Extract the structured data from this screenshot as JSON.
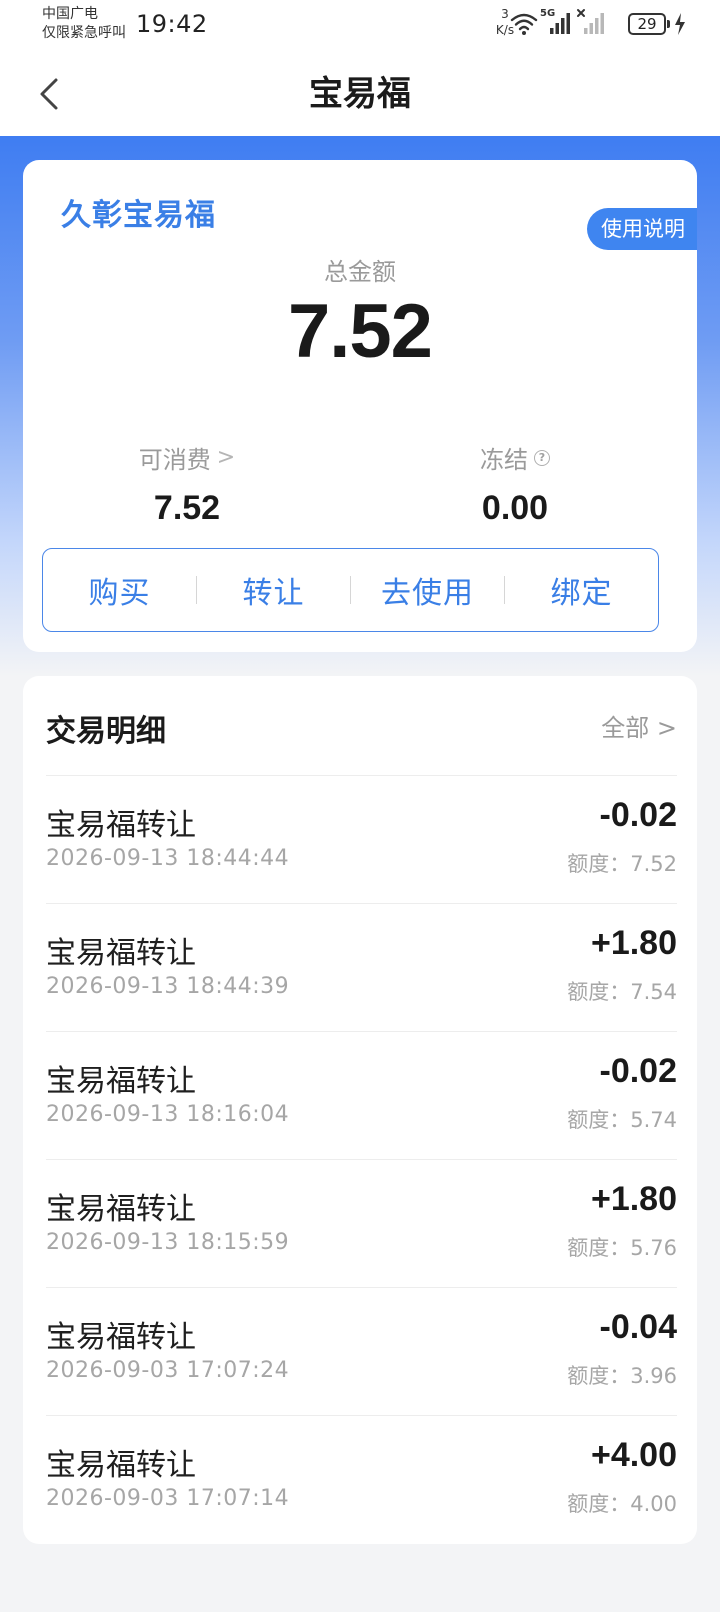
{
  "status_bar": {
    "carrier_line1": "中国广电",
    "carrier_line2": "仅限紧急呼叫",
    "time": "19:42",
    "net_speed_value": "3",
    "net_speed_unit": "K/s",
    "network_label": "5G",
    "battery_level": "29",
    "icons": [
      "wifi-icon",
      "signal-5g-icon",
      "signal-no-service-icon",
      "charging-icon"
    ]
  },
  "nav": {
    "title": "宝易福",
    "back_icon": "chevron-left-icon"
  },
  "summary": {
    "brand": "久彰宝易福",
    "instructions_label": "使用说明",
    "total_label": "总金额",
    "total_amount": "7.52",
    "available_label": "可消费",
    "available_chevron": ">",
    "available_value": "7.52",
    "frozen_label": "冻结",
    "frozen_help_glyph": "?",
    "frozen_value": "0.00",
    "actions": [
      {
        "label": "购买"
      },
      {
        "label": "转让"
      },
      {
        "label": "去使用"
      },
      {
        "label": "绑定"
      }
    ]
  },
  "transactions": {
    "title": "交易明细",
    "all_label": "全部 >",
    "items": [
      {
        "name": "宝易福转让",
        "time": "2026-09-13 18:44:44",
        "amount": "-0.02",
        "balance": "额度：7.52"
      },
      {
        "name": "宝易福转让",
        "time": "2026-09-13 18:44:39",
        "amount": "+1.80",
        "balance": "额度：7.54"
      },
      {
        "name": "宝易福转让",
        "time": "2026-09-13 18:16:04",
        "amount": "-0.02",
        "balance": "额度：5.74"
      },
      {
        "name": "宝易福转让",
        "time": "2026-09-13 18:15:59",
        "amount": "+1.80",
        "balance": "额度：5.76"
      },
      {
        "name": "宝易福转让",
        "time": "2026-09-03 17:07:24",
        "amount": "-0.04",
        "balance": "额度：3.96"
      },
      {
        "name": "宝易福转让",
        "time": "2026-09-03 17:07:14",
        "amount": "+4.00",
        "balance": "额度：4.00"
      }
    ]
  },
  "colors": {
    "accent": "#3a7fe6",
    "hero_top": "#3f7df2",
    "page_bg": "#f3f4f6"
  }
}
